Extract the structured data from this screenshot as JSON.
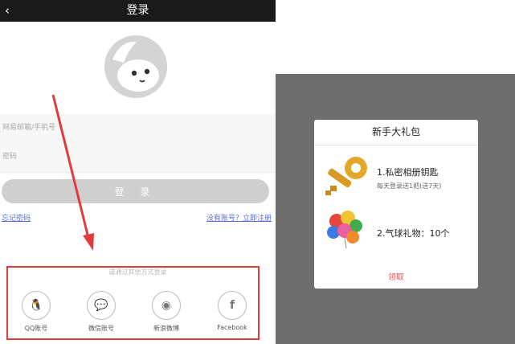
{
  "header": {
    "back_glyph": "‹",
    "title": "登录"
  },
  "form": {
    "email_placeholder": "网易邮箱/手机号",
    "password_placeholder": "密码",
    "login_label": "登 录"
  },
  "links": {
    "forgot": "忘记密码",
    "register": "没有账号？立即注册"
  },
  "other_login": {
    "label": "或通过其他方式登录",
    "options": [
      {
        "label": "QQ账号",
        "icon": "qq-icon",
        "glyph": "🐧"
      },
      {
        "label": "微信账号",
        "icon": "wechat-icon",
        "glyph": "💬"
      },
      {
        "label": "新浪微博",
        "icon": "weibo-icon",
        "glyph": "◉"
      },
      {
        "label": "Facebook",
        "icon": "facebook-icon",
        "glyph": "f"
      }
    ]
  },
  "gift_dialog": {
    "title": "新手大礼包",
    "item1": "1.私密相册钥匙",
    "item1_sub": "每天登录送1把(送7天)",
    "item2": "2.气球礼物：10个",
    "claim_label": "领取"
  },
  "colors": {
    "topbar": "#1a1a1a",
    "annotation_red": "#e23b3b",
    "link_blue": "#5a6fcf",
    "claim_red": "#e05757"
  }
}
